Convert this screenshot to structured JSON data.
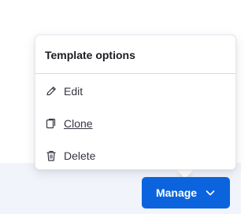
{
  "popover": {
    "title": "Template options",
    "items": [
      {
        "label": "Edit",
        "icon": "pencil-icon"
      },
      {
        "label": "Clone",
        "icon": "copy-icon"
      },
      {
        "label": "Delete",
        "icon": "trash-icon"
      }
    ]
  },
  "manage_button": {
    "label": "Manage",
    "icon": "chevron-down-icon"
  },
  "colors": {
    "button": "#0b64dd",
    "bar": "#f1f4fa",
    "text": "#343741"
  }
}
